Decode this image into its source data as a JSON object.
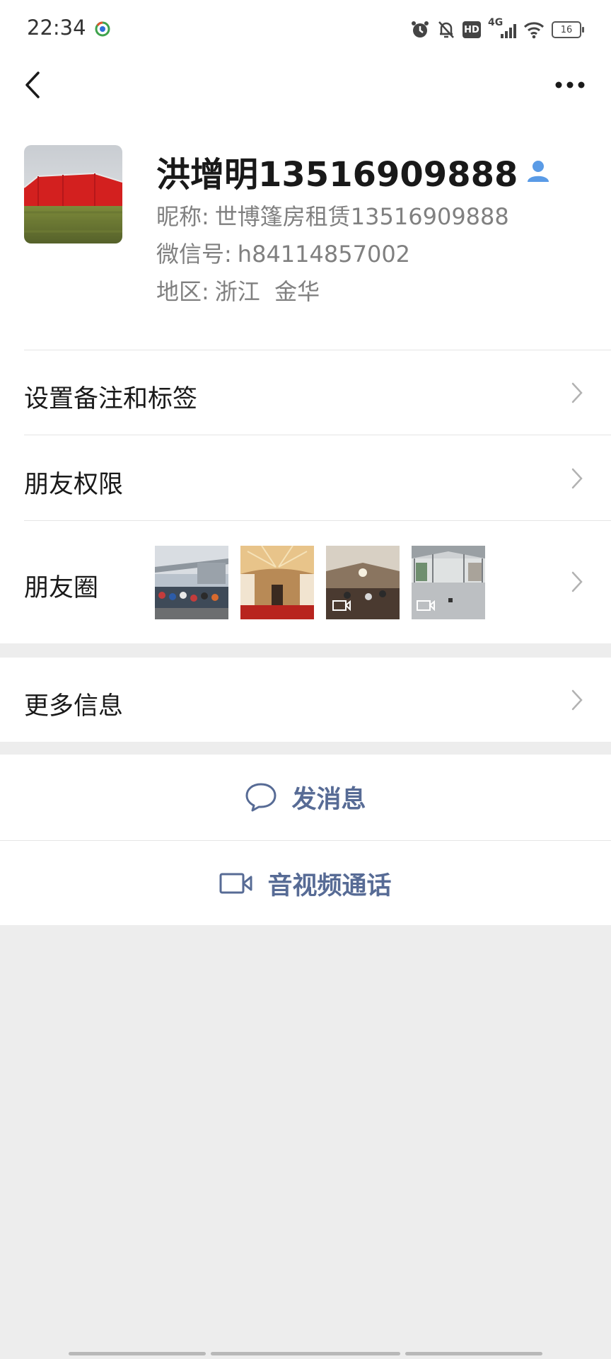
{
  "status_bar": {
    "time": "22:34",
    "network": "4G",
    "hd": "HD",
    "battery": "16",
    "icons": [
      "alarm-icon",
      "mute-bell-icon",
      "hd-icon",
      "signal-4g-icon",
      "wifi-icon",
      "battery-icon"
    ]
  },
  "nav": {
    "back_icon": "chevron-left-icon",
    "more_icon": "more-dots-icon"
  },
  "profile": {
    "name": "洪增明13516909888",
    "nickname_label": "昵称:",
    "nickname": "世博篷房租赁13516909888",
    "wechat_id_label": "微信号:",
    "wechat_id": "h84114857002",
    "region_label": "地区:",
    "region": "浙江  金华",
    "contact_icon": "person-icon"
  },
  "rows": {
    "remark_tags": "设置备注和标签",
    "friend_permissions": "朋友权限",
    "moments": "朋友圈",
    "more_info": "更多信息"
  },
  "moments_photos": [
    {
      "kind": "photo"
    },
    {
      "kind": "photo"
    },
    {
      "kind": "video"
    },
    {
      "kind": "video"
    }
  ],
  "actions": {
    "send_message": "发消息",
    "av_call": "音视频通话"
  },
  "colors": {
    "link_blue": "#576b95",
    "background_gray": "#ededed",
    "badge_blue": "#4b8ee6"
  }
}
